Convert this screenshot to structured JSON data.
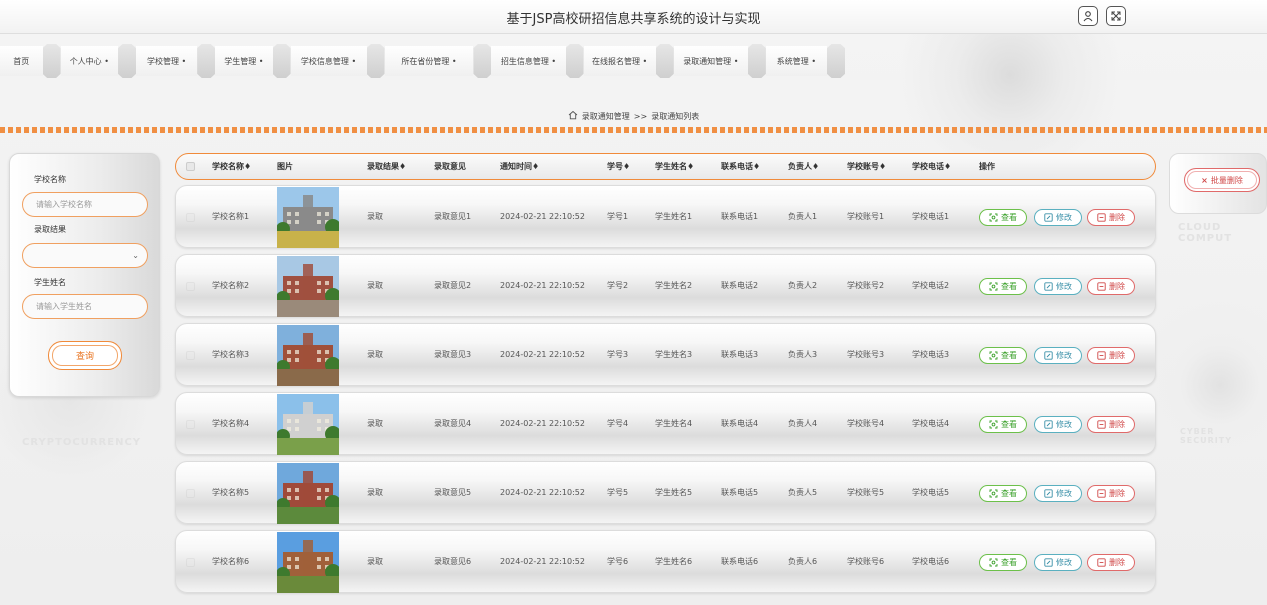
{
  "app": {
    "title": "基于JSP高校研招信息共享系统的设计与实现"
  },
  "nav": [
    "首页",
    "个人中心 •",
    "学校管理 •",
    "学生管理 •",
    "学校信息管理 •",
    "所在省份管理 •",
    "招生信息管理 •",
    "在线报名管理 •",
    "录取通知管理 •",
    "系统管理 •"
  ],
  "breadcrumb": {
    "parent": "录取通知管理",
    "sep": ">>",
    "current": "录取通知列表"
  },
  "search": {
    "school_label": "学校名称",
    "school_placeholder": "请输入学校名称",
    "result_label": "录取结果",
    "student_label": "学生姓名",
    "student_placeholder": "请输入学生姓名",
    "button": "查询"
  },
  "batch_delete": "批量删除",
  "table": {
    "headers": [
      "学校名称♦",
      "图片",
      "录取结果♦",
      "录取意见",
      "通知时间♦",
      "学号♦",
      "学生姓名♦",
      "联系电话♦",
      "负责人♦",
      "学校账号♦",
      "学校电话♦",
      "操作"
    ],
    "actions": {
      "view": "查看",
      "edit": "修改",
      "delete": "删除"
    },
    "rows": [
      [
        "学校名称1",
        "录取",
        "录取意见1",
        "2024-02-21 22:10:52",
        "学号1",
        "学生姓名1",
        "联系电话1",
        "负责人1",
        "学校账号1",
        "学校电话1"
      ],
      [
        "学校名称2",
        "录取",
        "录取意见2",
        "2024-02-21 22:10:52",
        "学号2",
        "学生姓名2",
        "联系电话2",
        "负责人2",
        "学校账号2",
        "学校电话2"
      ],
      [
        "学校名称3",
        "录取",
        "录取意见3",
        "2024-02-21 22:10:52",
        "学号3",
        "学生姓名3",
        "联系电话3",
        "负责人3",
        "学校账号3",
        "学校电话3"
      ],
      [
        "学校名称4",
        "录取",
        "录取意见4",
        "2024-02-21 22:10:52",
        "学号4",
        "学生姓名4",
        "联系电话4",
        "负责人4",
        "学校账号4",
        "学校电话4"
      ],
      [
        "学校名称5",
        "录取",
        "录取意见5",
        "2024-02-21 22:10:52",
        "学号5",
        "学生姓名5",
        "联系电话5",
        "负责人5",
        "学校账号5",
        "学校电话5"
      ],
      [
        "学校名称6",
        "录取",
        "录取意见6",
        "2024-02-21 22:10:52",
        "学号6",
        "学生姓名6",
        "联系电话6",
        "负责人6",
        "学校账号6",
        "学校电话6"
      ]
    ]
  },
  "background_text": {
    "cloud": "CLOUD COMPUT",
    "crypto": "CRYPTOCURRENCY",
    "cyber": "CYBER SECURITY"
  }
}
